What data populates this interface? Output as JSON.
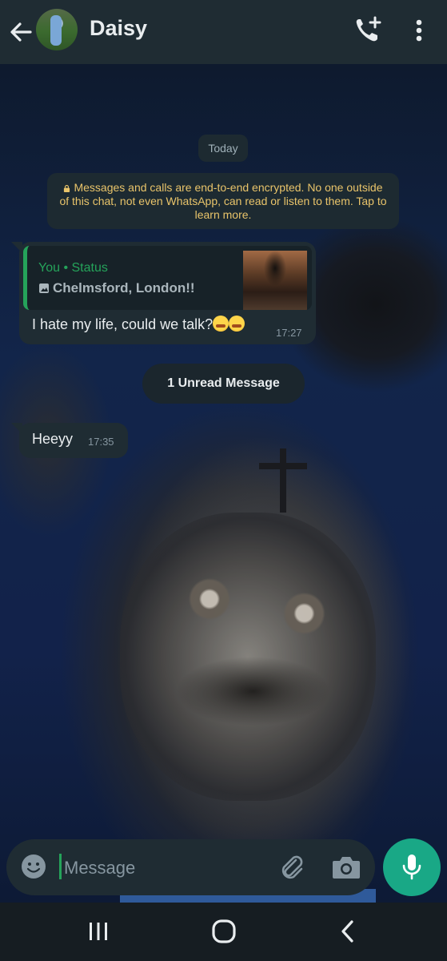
{
  "header": {
    "title": "Daisy",
    "icons": [
      "back-arrow-icon",
      "contact-avatar",
      "add-call-icon",
      "more-vertical-icon"
    ]
  },
  "chat": {
    "date_chip": "Today",
    "encryption_notice": "Messages and calls are end-to-end encrypted. No one outside of this chat, not even WhatsApp, can read or listen to them. Tap to learn more.",
    "messages": [
      {
        "direction": "incoming",
        "quote": {
          "author": "You • Status",
          "subtitle": "Chelmsford, London!!",
          "subtitle_icon": "image-icon"
        },
        "text": "I hate my life, could we talk?",
        "emojis": [
          "face-with-hand-over-mouth",
          "face-with-hand-over-mouth"
        ],
        "time": "17:27"
      },
      {
        "direction": "incoming",
        "text": "Heeyy",
        "time": "17:35"
      }
    ],
    "unread_chip": "1 Unread Message"
  },
  "composer": {
    "placeholder": "Message",
    "value": "",
    "icons": [
      "emoji-icon",
      "attach-icon",
      "camera-icon",
      "mic-icon"
    ]
  },
  "navbar": {
    "icons": [
      "recent-apps-icon",
      "home-icon",
      "nav-back-icon"
    ]
  },
  "colors": {
    "header_bg": "#1f2c33",
    "bubble_bg": "#1f2c33",
    "accent_green": "#25a35a",
    "mic_button": "#19a886",
    "notice_text": "#e9c46a"
  }
}
